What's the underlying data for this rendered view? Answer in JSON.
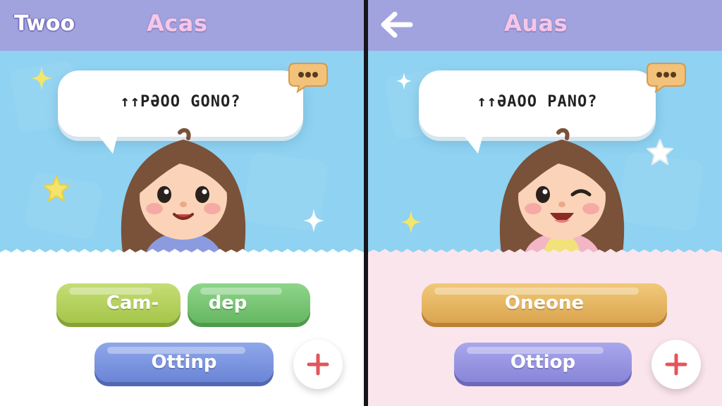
{
  "left": {
    "brand": "Twoo",
    "title": "Acas",
    "bubble_text": "↑↑PƏOO GONO?",
    "buttons": {
      "yellow": "Cam-",
      "green": "dep",
      "primary": "Ottinp"
    }
  },
  "right": {
    "title": "Auas",
    "bubble_text": "↑↑ƏAOO PANO?",
    "buttons": {
      "top": "Oneone",
      "primary": "Ottiop"
    }
  },
  "colors": {
    "header": "#a1a3de",
    "title": "#f6c6e8",
    "sky": "#8fd2f1",
    "left_bottom": "#ffffff",
    "right_bottom": "#fbe5ec",
    "plus": "#e2565b"
  },
  "icons": [
    "back-arrow-icon",
    "chat-bubble-icon",
    "star-icon",
    "sparkle-icon",
    "plus-icon"
  ]
}
